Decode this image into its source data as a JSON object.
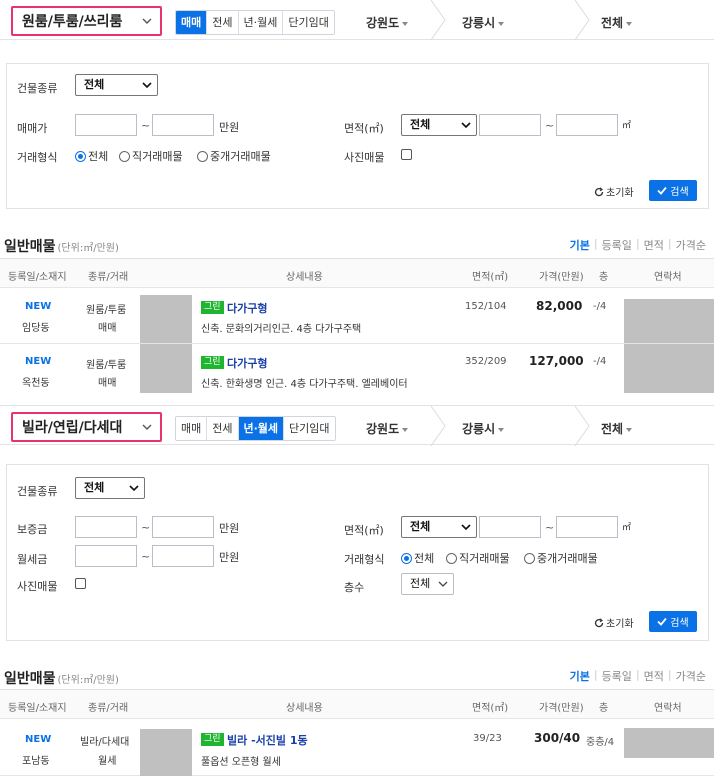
{
  "panel1": {
    "property_type": "원룸/투룸/쓰리룸",
    "tabs": [
      {
        "label": "매매",
        "active": true
      },
      {
        "label": "전세",
        "active": false
      },
      {
        "label": "년·월세",
        "active": false
      },
      {
        "label": "단기임대",
        "active": false
      }
    ],
    "region1": "강원도",
    "region2": "강릉시",
    "region3": "전체",
    "filters": {
      "building_type_label": "건물종류",
      "building_type_value": "전체",
      "price_label": "매매가",
      "price_unit": "만원",
      "area_label": "면적(㎡)",
      "area_value": "전체",
      "area_unit": "㎡",
      "deal_type_label": "거래형식",
      "deal_opts": [
        "전체",
        "직거래매물",
        "중개거래매물"
      ],
      "photo_label": "사진매물",
      "reset_label": "초기화",
      "search_label": "검색"
    },
    "listing": {
      "title": "일반매물",
      "unit_note": "(단위:㎡/만원)",
      "sort_options": [
        "기본",
        "등록일",
        "면적",
        "가격순"
      ],
      "columns": [
        "등록일/소재지",
        "종류/거래",
        "상세내용",
        "면적(㎡)",
        "가격(만원)",
        "층",
        "연락처"
      ],
      "rows": [
        {
          "new": "NEW",
          "location": "임당동",
          "kind": "원룸/투룸",
          "deal": "매매",
          "badge": "그린",
          "title": "다가구형",
          "desc": "신축. 문화의거리인근. 4층 다가구주택",
          "area": "152/104",
          "price": "82,000",
          "floor": "-/4"
        },
        {
          "new": "NEW",
          "location": "옥천동",
          "kind": "원룸/투룸",
          "deal": "매매",
          "badge": "그린",
          "title": "다가구형",
          "desc": "신축. 한화생명 인근. 4층 다가구주택. 엘레베이터",
          "area": "352/209",
          "price": "127,000",
          "floor": "-/4"
        }
      ]
    }
  },
  "panel2": {
    "property_type": "빌라/연립/다세대",
    "tabs": [
      {
        "label": "매매",
        "active": false
      },
      {
        "label": "전세",
        "active": false
      },
      {
        "label": "년·월세",
        "active": true
      },
      {
        "label": "단기임대",
        "active": false
      }
    ],
    "region1": "강원도",
    "region2": "강릉시",
    "region3": "전체",
    "filters": {
      "building_type_label": "건물종류",
      "building_type_value": "전체",
      "deposit_label": "보증금",
      "deposit_unit": "만원",
      "rent_label": "월세금",
      "rent_unit": "만원",
      "area_label": "면적(㎡)",
      "area_value": "전체",
      "area_unit": "㎡",
      "deal_type_label": "거래형식",
      "deal_opts": [
        "전체",
        "직거래매물",
        "중개거래매물"
      ],
      "photo_label": "사진매물",
      "floors_label": "층수",
      "floors_value": "전체",
      "reset_label": "초기화",
      "search_label": "검색"
    },
    "listing": {
      "title": "일반매물",
      "unit_note": "(단위:㎡/만원)",
      "sort_options": [
        "기본",
        "등록일",
        "면적",
        "가격순"
      ],
      "columns": [
        "등록일/소재지",
        "종류/거래",
        "상세내용",
        "면적(㎡)",
        "가격(만원)",
        "층",
        "연락처"
      ],
      "rows": [
        {
          "new": "NEW",
          "location": "포남동",
          "kind": "빌라/다세대",
          "deal": "월세",
          "badge": "그린",
          "title": "빌라 -서진빌 1동",
          "desc": "풀옵션 오픈형 월세",
          "area": "39/23",
          "price": "300/40",
          "floor": "중층/4"
        }
      ]
    }
  }
}
